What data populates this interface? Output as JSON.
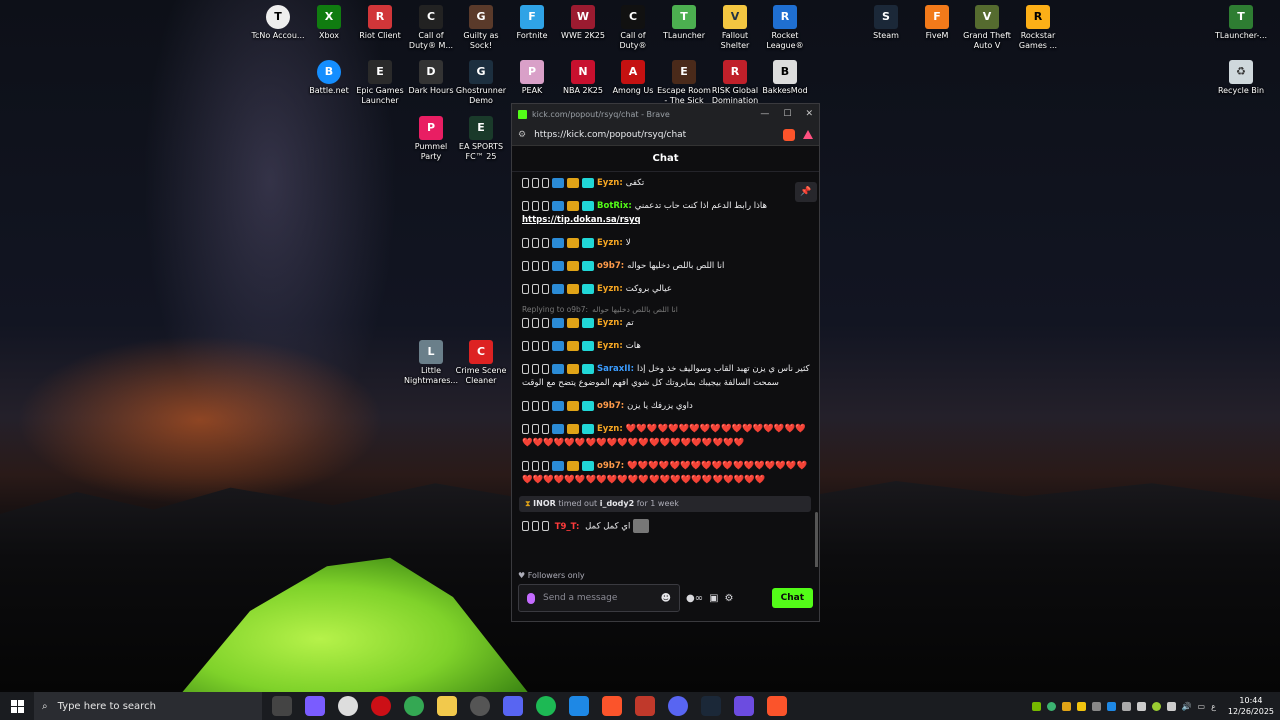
{
  "desktop": {
    "icons_row1": [
      "TcNo Accou...",
      "Xbox",
      "Riot Client",
      "Call of Duty® M...",
      "Guilty as Sock!",
      "Fortnite",
      "WWE 2K25",
      "Call of Duty®",
      "TLauncher",
      "Fallout Shelter",
      "Rocket League®",
      "Steam",
      "FiveM",
      "Grand Theft Auto V",
      "Rockstar Games ...",
      "TLauncher-..."
    ],
    "icons_row2": [
      "Battle.net",
      "Epic Games Launcher",
      "Dark Hours",
      "Ghostrunner Demo",
      "PEAK",
      "NBA 2K25",
      "Among Us",
      "Escape Room - The Sick C...",
      "RISK Global Domination",
      "BakkesMod",
      "Recycle Bin"
    ],
    "icons_row3": [
      "Pummel Party",
      "EA SPORTS FC™ 25"
    ],
    "icons_mid": [
      "Little Nightmares...",
      "Crime Scene Cleaner"
    ]
  },
  "browser": {
    "title": "kick.com/popout/rsyq/chat - Brave",
    "url": "https://kick.com/popout/rsyq/chat",
    "controls": {
      "minimize": "—",
      "maximize": "☐",
      "close": "✕"
    }
  },
  "chat": {
    "header": "Chat",
    "pin_icon": "pin-icon",
    "messages": [
      {
        "user": "Eyzn:",
        "color": "#f5a623",
        "text": "تكفى"
      },
      {
        "user": "BotRix:",
        "color": "#53fc18",
        "text": "هاذا رابط الدعم اذا كنت حاب تدعمني",
        "link": "https://tip.dokan.sa/rsyq"
      },
      {
        "user": "Eyzn:",
        "color": "#f5a623",
        "text": "لا"
      },
      {
        "user": "o9b7:",
        "color": "#ff9b4a",
        "text": "انا اللص باللص دخليها حواله"
      },
      {
        "user": "Eyzn:",
        "color": "#f5a623",
        "text": "عيالي بروكت"
      },
      {
        "reply": "Replying to o9b7:",
        "reply_text": "انا اللص باللص دخليها حواله",
        "user": "Eyzn:",
        "color": "#f5a623",
        "text": "تم"
      },
      {
        "user": "Eyzn:",
        "color": "#f5a623",
        "text": "هات"
      },
      {
        "user": "SaraxII:",
        "color": "#3b9cff",
        "text": "كثير ناس ي يزن تهبد القاب وسواليف خذ وخل إذا سمحت السالفة بيجيبك بمايروتك كل شوي افهم الموضوع يتضح مع الوقت"
      },
      {
        "user": "o9b7:",
        "color": "#ff9b4a",
        "text": "داوي يزرفك يا يزن"
      },
      {
        "user": "Eyzn:",
        "color": "#f5a623",
        "text": "❤️❤️❤️❤️❤️❤️❤️❤️❤️❤️❤️❤️❤️❤️❤️❤️❤️❤️❤️❤️❤️❤️❤️❤️❤️❤️❤️❤️❤️❤️❤️❤️❤️❤️❤️❤️❤️❤️"
      },
      {
        "user": "o9b7:",
        "color": "#ff9b4a",
        "text": "❤️❤️❤️❤️❤️❤️❤️❤️❤️❤️❤️❤️❤️❤️❤️❤️❤️❤️❤️❤️❤️❤️❤️❤️❤️❤️❤️❤️❤️❤️❤️❤️❤️❤️❤️❤️❤️❤️❤️❤️"
      }
    ],
    "system": {
      "actor": "INOR",
      "mid": "timed out",
      "target": "i_dody2",
      "tail": "for 1 week"
    },
    "last_message": {
      "user": "T9_T:",
      "color": "#ff3b3b",
      "text": "اي كمل كمل"
    },
    "followers_only": "Followers only",
    "input_placeholder": "Send a message",
    "send_label": "Chat"
  },
  "taskbar": {
    "search_placeholder": "Type here to search",
    "time": "10:44",
    "date": "12/26/2025",
    "lang": "ع"
  }
}
